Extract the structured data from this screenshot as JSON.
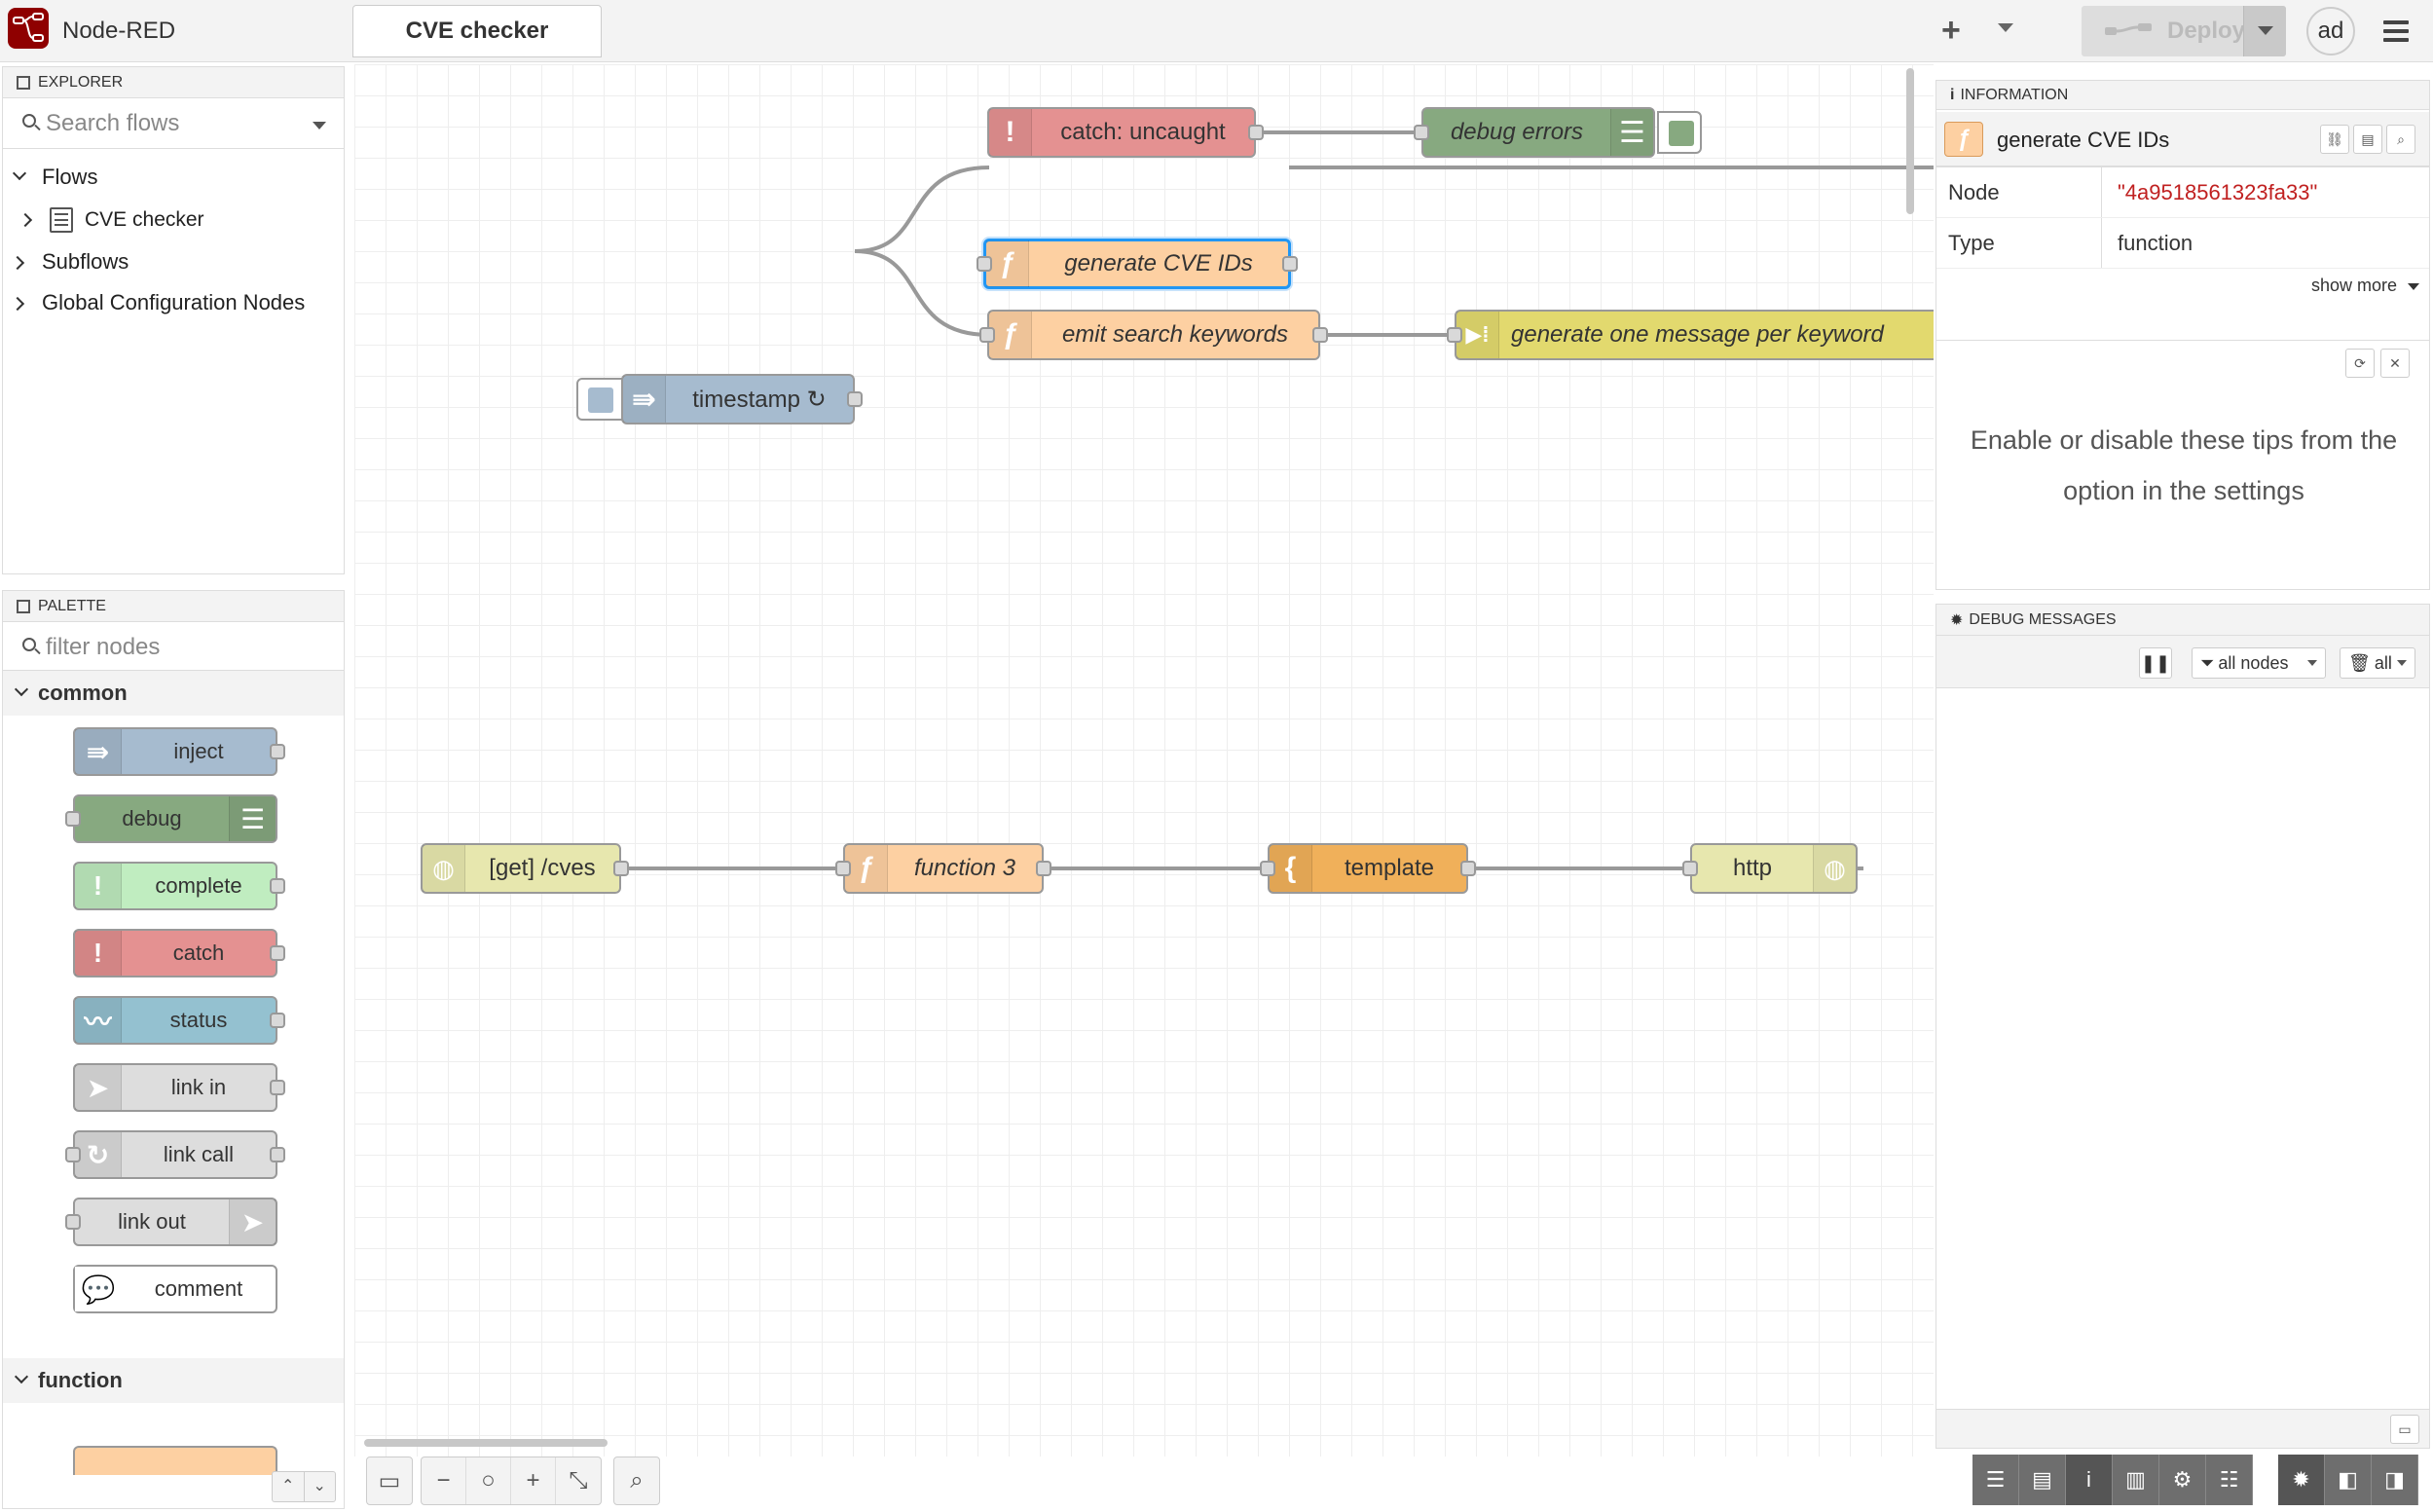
{
  "header": {
    "app_title": "Node-RED",
    "active_tab": "CVE checker",
    "add_label": "+",
    "deploy_label": "Deploy",
    "user_initials": "ad"
  },
  "explorer": {
    "title": "EXPLORER",
    "search_placeholder": "Search flows",
    "tree": {
      "flows": "Flows",
      "flow_item": "CVE checker",
      "subflows": "Subflows",
      "global_config": "Global Configuration Nodes"
    }
  },
  "palette": {
    "title": "PALETTE",
    "filter_placeholder": "filter nodes",
    "category_common": "common",
    "category_function": "function",
    "nodes": [
      "inject",
      "debug",
      "complete",
      "catch",
      "status",
      "link in",
      "link call",
      "link out",
      "comment"
    ]
  },
  "canvas": {
    "nodes": {
      "catch_uncaught": "catch: uncaught",
      "debug_errors": "debug errors",
      "generate_cve_ids": "generate CVE IDs",
      "timestamp": "timestamp ↻",
      "emit_search_keywords": "emit search keywords",
      "gen_msg_per_keyword": "generate one message per keyword",
      "get_cves": "[get] /cves",
      "function3": "function 3",
      "template": "template",
      "http": "http"
    }
  },
  "info": {
    "title": "INFORMATION",
    "node_name": "generate CVE IDs",
    "rows": [
      {
        "key": "Node",
        "value": "\"4a9518561323fa33\""
      },
      {
        "key": "Type",
        "value": "function"
      }
    ],
    "show_more": "show more",
    "tip_text": "Enable or disable these tips from the option in the settings"
  },
  "debug": {
    "title": "DEBUG MESSAGES",
    "filter_nodes": "all nodes",
    "clear_all": "all"
  },
  "colors": {
    "inject": "#a6bbcf",
    "debug": "#87a980",
    "complete": "#c0edc0",
    "catch": "#e49191",
    "status": "#94c1d0",
    "link": "#dddddd",
    "function": "#fdd0a2",
    "split": "#e2d96e",
    "template": "#f0b05a",
    "http": "#e7e7ae",
    "logo": "#8f0000",
    "selected": "#2196f3",
    "info_value": "#c02020"
  }
}
